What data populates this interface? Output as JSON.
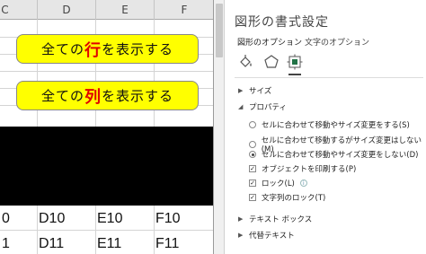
{
  "sheet": {
    "columns": [
      "C",
      "D",
      "E",
      "F"
    ],
    "macro_buttons": [
      {
        "prefix": "全ての",
        "highlight": "行",
        "suffix": "を表示する"
      },
      {
        "prefix": "全ての",
        "highlight": "列",
        "suffix": "を表示する"
      }
    ],
    "rows": [
      [
        "0",
        "D10",
        "E10",
        "F10"
      ],
      [
        "1",
        "D11",
        "E11",
        "F11"
      ]
    ]
  },
  "pane": {
    "title": "図形の書式設定",
    "tabs": [
      "図形のオプション",
      "文字のオプション"
    ],
    "categories": [
      "fill-line-icon",
      "effects-pentagon-icon",
      "size-properties-icon"
    ],
    "sections": {
      "size": "サイズ",
      "properties": "プロパティ",
      "textbox": "テキスト ボックス",
      "alt_text": "代替テキスト"
    },
    "radio_options": [
      {
        "label": "セルに合わせて移動やサイズ変更をする(S)",
        "selected": false
      },
      {
        "label": "セルに合わせて移動するがサイズ変更はしない(M)",
        "selected": false
      },
      {
        "label": "セルに合わせて移動やサイズ変更をしない(D)",
        "selected": true
      }
    ],
    "check_options": [
      {
        "label": "オブジェクトを印刷する(P)",
        "checked": true
      },
      {
        "label": "ロック(L)",
        "checked": true
      },
      {
        "label": "文字列のロック(T)",
        "checked": true
      }
    ],
    "accent_color": "#217346"
  }
}
